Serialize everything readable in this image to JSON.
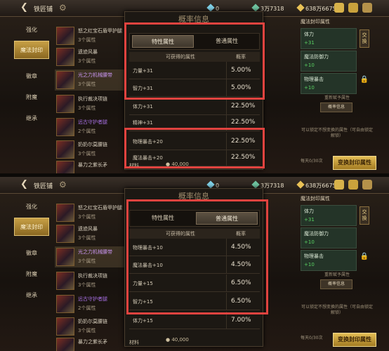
{
  "panels": [
    {
      "header": {
        "title": "铁匠铺",
        "currency1": "0",
        "currency2": "3万7318",
        "currency3": "638万6675"
      },
      "sidebar": [
        "强化",
        "魔法封印",
        "徽章",
        "附魔",
        "继承"
      ],
      "sidebar_active": 1,
      "items": [
        {
          "name": "怒之红宝石盾甲护腿",
          "count": "3个属性"
        },
        {
          "name": "遗迹风暴",
          "count": "3个属性"
        },
        {
          "name": "光之力机械腰带",
          "count": "3个属性"
        },
        {
          "name": "执行裁决项链",
          "count": "3个属性"
        },
        {
          "name": "远古守护者腿",
          "count": "2个属性"
        },
        {
          "name": "奶奶尔莫腰链",
          "count": "3个属性"
        },
        {
          "name": "暴力之紫长矛",
          "count": "3个属性"
        }
      ],
      "dialog": {
        "title": "概率信息",
        "tab_special": "特性属性",
        "tab_normal": "普通属性",
        "active_tab": "special",
        "col_attr": "可获得的属性",
        "col_prob": "概率",
        "rows": [
          {
            "attr": "力量+31",
            "prob": "5.00%"
          },
          {
            "attr": "智力+31",
            "prob": "5.00%"
          },
          {
            "attr": "体力+31",
            "prob": "22.50%"
          },
          {
            "attr": "精神+31",
            "prob": "22.50%"
          },
          {
            "attr": "物理暴击+20",
            "prob": "22.50%"
          },
          {
            "attr": "魔法暴击+20",
            "prob": "22.50%"
          }
        ],
        "footer": "材料"
      },
      "cost": "40,000",
      "right": {
        "header": "魔法封印属性",
        "attrs": [
          {
            "key": "体力",
            "value": "+31"
          },
          {
            "key": "魔法防御力",
            "value": "+10"
          },
          {
            "key": "物理暴击",
            "value": "+10"
          }
        ],
        "lock_label": "交换",
        "desc1": "重新赋予属性",
        "rate_btn": "概率信息",
        "desc2": "可以锁定不想变换的属性（可自由锁定解锁）",
        "daily": "每天0/30次",
        "main_btn": "变换封印属性"
      }
    },
    {
      "header": {
        "title": "铁匠铺",
        "currency1": "0",
        "currency2": "3万7318",
        "currency3": "638万6675"
      },
      "sidebar": [
        "强化",
        "魔法封印",
        "徽章",
        "附魔",
        "继承"
      ],
      "sidebar_active": 1,
      "items": [
        {
          "name": "怒之红宝石盾甲护腿",
          "count": "3个属性"
        },
        {
          "name": "遗迹风暴",
          "count": "3个属性"
        },
        {
          "name": "光之力机械腰带",
          "count": "3个属性"
        },
        {
          "name": "执行裁决项链",
          "count": "3个属性"
        },
        {
          "name": "远古守护者腿",
          "count": "2个属性"
        },
        {
          "name": "奶奶尔莫腰链",
          "count": "3个属性"
        },
        {
          "name": "暴力之紫长矛",
          "count": "3个属性"
        }
      ],
      "dialog": {
        "title": "概率信息",
        "tab_special": "特性属性",
        "tab_normal": "普通属性",
        "active_tab": "normal",
        "col_attr": "可获得的属性",
        "col_prob": "概率",
        "rows": [
          {
            "attr": "物理暴击+10",
            "prob": "4.50%"
          },
          {
            "attr": "魔法暴击+10",
            "prob": "4.50%"
          },
          {
            "attr": "力量+15",
            "prob": "6.50%"
          },
          {
            "attr": "智力+15",
            "prob": "6.50%"
          },
          {
            "attr": "体力+15",
            "prob": "7.00%"
          }
        ],
        "footer": "材料"
      },
      "cost": "40,000",
      "right": {
        "header": "魔法封印属性",
        "attrs": [
          {
            "key": "体力",
            "value": "+31"
          },
          {
            "key": "魔法防御力",
            "value": "+10"
          },
          {
            "key": "物理暴击",
            "value": "+10"
          }
        ],
        "lock_label": "交换",
        "desc1": "重新赋予属性",
        "rate_btn": "概率信息",
        "desc2": "可以锁定不想变换的属性（可自由锁定解锁）",
        "daily": "每天0/30次",
        "main_btn": "变换封印属性"
      }
    }
  ],
  "colors": {
    "highlight": "#e0433f",
    "accent_gold": "#c7a046",
    "value_green": "#59d162"
  }
}
